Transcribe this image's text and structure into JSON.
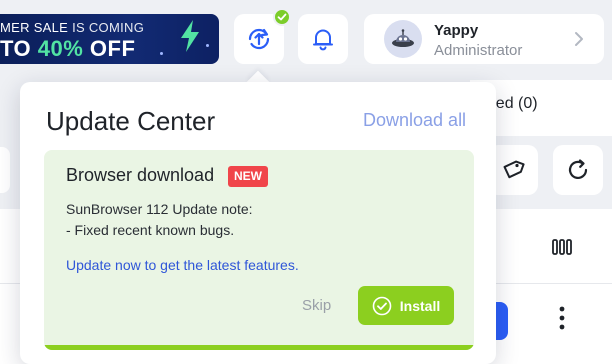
{
  "promo": {
    "line1_a": "MER SALE",
    "line1_b": " IS COMING",
    "line2_a": "TO ",
    "line2_pct": "40%",
    "line2_b": " OFF"
  },
  "user": {
    "name": "Yappy",
    "role": "Administrator"
  },
  "background": {
    "opened_label": "ened (0)"
  },
  "popover": {
    "title": "Update Center",
    "download_all": "Download all",
    "card": {
      "title": "Browser download",
      "badge": "NEW",
      "note_line1": "SunBrowser 112 Update note:",
      "note_line2": "- Fixed recent known bugs.",
      "link": "Update now to get the latest features.",
      "skip": "Skip",
      "install": "Install"
    }
  },
  "colors": {
    "accent_green": "#8ccf1f",
    "badge_red": "#f0454a",
    "link_blue": "#2f56d8",
    "primary_blue": "#2b5ef7"
  },
  "icons": {
    "update": "update-icon",
    "bell": "bell-icon",
    "check": "check-icon",
    "avatar": "alien-avatar-icon",
    "chevron": "chevron-right-icon",
    "tag": "tag-icon",
    "refresh": "refresh-icon",
    "columns": "columns-icon",
    "kebab": "kebab-menu-icon",
    "install": "check-circle-icon"
  }
}
